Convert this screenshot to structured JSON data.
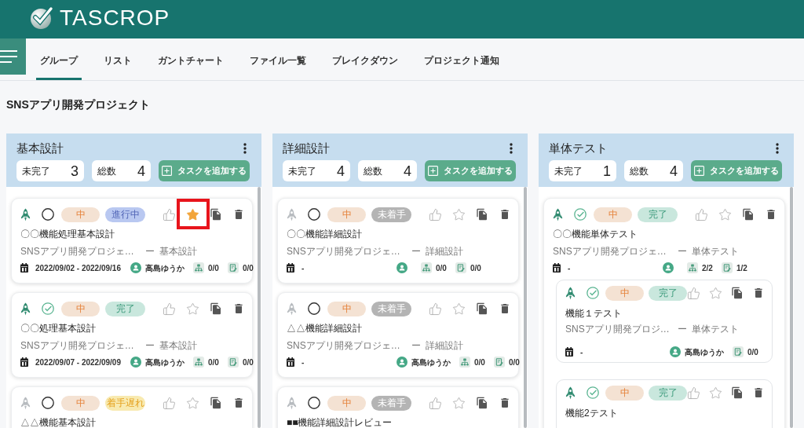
{
  "header": {
    "logo": "TASCROP"
  },
  "nav": {
    "tabs": [
      {
        "label": "グループ",
        "selected": true
      },
      {
        "label": "リスト",
        "selected": false
      },
      {
        "label": "ガントチャート",
        "selected": false
      },
      {
        "label": "ファイル一覧",
        "selected": false
      },
      {
        "label": "ブレイクダウン",
        "selected": false
      },
      {
        "label": "プロジェクト通知",
        "selected": false
      }
    ]
  },
  "project_title": "SNSアプリ開発プロジェクト",
  "columns": [
    {
      "title": "基本設計",
      "stats": [
        {
          "label": "未完了",
          "value": "3"
        },
        {
          "label": "総数",
          "value": "4"
        }
      ],
      "add_button": "タスクを追加する",
      "tasks": [
        {
          "done": false,
          "priority": "中",
          "status": {
            "label": "進行中",
            "kind": "in_progress"
          },
          "starred": true,
          "highlighted": true,
          "title": "〇〇機能処理基本設計",
          "project": "SNSアプリ開発プロジェ…",
          "separator": "ー",
          "group": "基本設計",
          "dates": "2022/09/02 - 2022/09/16",
          "assignee": "高島ゆうか",
          "subtasks": "0/0",
          "checklist": "0/0"
        },
        {
          "done": true,
          "priority": "中",
          "status": {
            "label": "完了",
            "kind": "done"
          },
          "starred": false,
          "title": "〇〇処理基本設計",
          "project": "SNSアプリ開発プロジェ…",
          "separator": "ー",
          "group": "基本設計",
          "dates": "2022/09/07 - 2022/09/09",
          "assignee": "高島ゆうか",
          "subtasks": "0/0",
          "checklist": "0/0"
        },
        {
          "done": false,
          "priority": "中",
          "status": {
            "label": "着手遅れ",
            "kind": "late"
          },
          "starred": false,
          "title": "△△機能基本設計"
        }
      ]
    },
    {
      "title": "詳細設計",
      "stats": [
        {
          "label": "未完了",
          "value": "4"
        },
        {
          "label": "総数",
          "value": "4"
        }
      ],
      "add_button": "タスクを追加する",
      "tasks": [
        {
          "done": false,
          "priority": "中",
          "status": {
            "label": "未着手",
            "kind": "not_started"
          },
          "starred": false,
          "title": "〇〇機能詳細設計",
          "project": "SNSアプリ開発プロジェ…",
          "separator": "ー",
          "group": "詳細設計",
          "dates": "-",
          "subtasks": "0/0",
          "checklist": "0/0"
        },
        {
          "done": false,
          "priority": "中",
          "status": {
            "label": "未着手",
            "kind": "not_started"
          },
          "starred": false,
          "title": "△△機能詳細設計",
          "project": "SNSアプリ開発プロジェ…",
          "separator": "ー",
          "group": "詳細設計",
          "dates": "-",
          "assignee": "高島ゆうか",
          "subtasks": "0/0",
          "checklist": "0/0"
        },
        {
          "done": false,
          "priority": "中",
          "status": {
            "label": "未着手",
            "kind": "not_started"
          },
          "starred": false,
          "title": "■■機能詳細設計レビュー"
        }
      ]
    },
    {
      "title": "単体テスト",
      "stats": [
        {
          "label": "未完了",
          "value": "1"
        },
        {
          "label": "総数",
          "value": "4"
        }
      ],
      "add_button": "タスクを追加する",
      "tasks": [
        {
          "done": true,
          "priority": "中",
          "status": {
            "label": "完了",
            "kind": "done"
          },
          "starred": false,
          "title": "〇〇機能単体テスト",
          "project": "SNSアプリ開発プロジェ…",
          "separator": "ー",
          "group": "単体テスト",
          "dates": "-",
          "subtasks": "2/2",
          "checklist": "1/2",
          "children": [
            {
              "done": true,
              "priority": "中",
              "status": {
                "label": "完了",
                "kind": "done"
              },
              "starred": false,
              "title": "機能１テスト",
              "project": "SNSアプリ開発プロジ…",
              "separator": "ー",
              "group": "単体テスト",
              "dates": "-",
              "assignee": "高島ゆうか",
              "checklist": "0/0"
            },
            {
              "done": true,
              "priority": "中",
              "status": {
                "label": "完了",
                "kind": "done"
              },
              "starred": false,
              "title": "機能2テスト"
            }
          ]
        }
      ]
    }
  ]
}
